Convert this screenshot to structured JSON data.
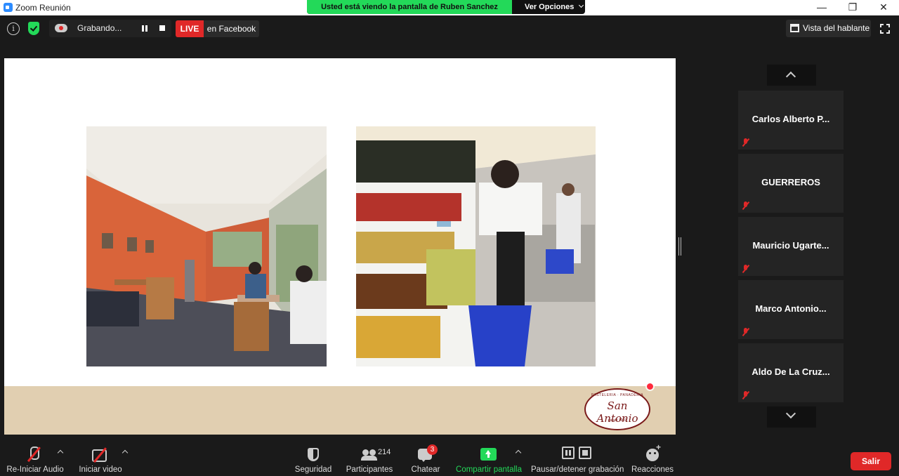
{
  "window": {
    "title": "Zoom Reunión",
    "controls": {
      "minimize": "—",
      "restore": "❐",
      "close": "✕"
    }
  },
  "share_banner": {
    "message": "Usted está viendo la pantalla de Ruben Sanchez",
    "options_label": "Ver Opciones",
    "color": "#23d959"
  },
  "top_bar": {
    "recording_label": "Grabando...",
    "live_label": "LIVE",
    "live_target": "en Facebook",
    "view_label": "Vista del hablante"
  },
  "slide": {
    "background": "#ffffff",
    "footer_color": "#e1cfb1",
    "logo": {
      "arc_text": "PASTELERIA · PANADERIA",
      "brand": "San Antonio",
      "since": "desde 1959"
    }
  },
  "participants": [
    {
      "name": "Carlos Alberto P...",
      "muted": true
    },
    {
      "name": "GUERREROS",
      "muted": true
    },
    {
      "name": "Mauricio  Ugarte...",
      "muted": true
    },
    {
      "name": "Marco  Antonio...",
      "muted": true
    },
    {
      "name": "Aldo De La Cruz...",
      "muted": true
    }
  ],
  "toolbar": {
    "audio_label": "Re-Iniciar Audio",
    "video_label": "Iniciar video",
    "security_label": "Seguridad",
    "participants_label": "Participantes",
    "participants_count": "214",
    "chat_label": "Chatear",
    "chat_badge": "3",
    "share_label": "Compartir pantalla",
    "record_label": "Pausar/detener grabación",
    "reactions_label": "Reacciones",
    "leave_label": "Salir"
  },
  "colors": {
    "accent_green": "#23d959",
    "danger_red": "#e02828",
    "background": "#1a1a1a"
  }
}
